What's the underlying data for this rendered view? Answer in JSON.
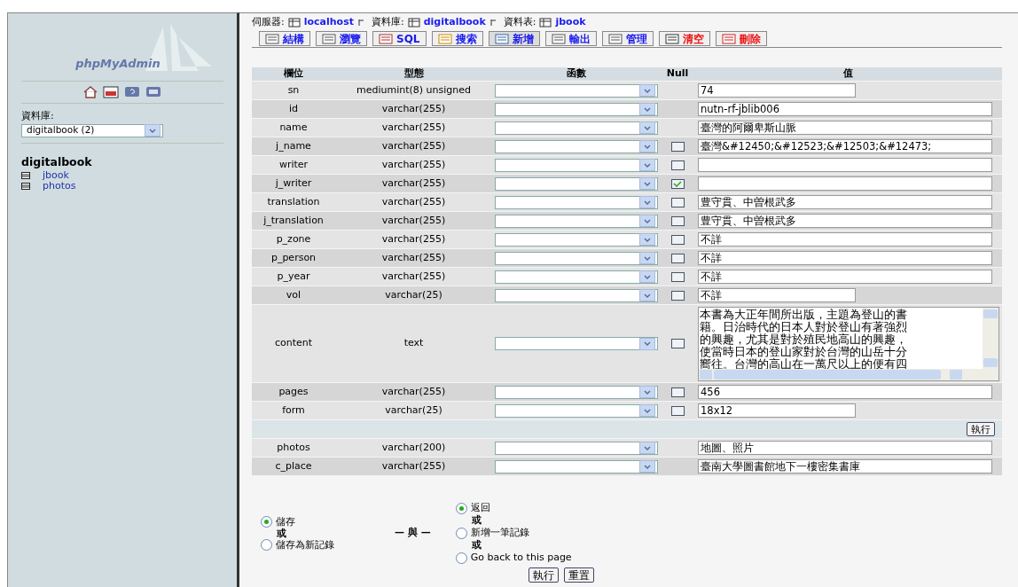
{
  "sidebar": {
    "logo": "phpMyAdmin",
    "db_label": "資料庫:",
    "db_select": "digitalbook (2)",
    "db_name": "digitalbook",
    "tables": [
      "jbook",
      "photos"
    ]
  },
  "breadcrumb": [
    {
      "label": "伺服器:",
      "value": "localhost"
    },
    {
      "label": "資料庫:",
      "value": "digitalbook"
    },
    {
      "label": "資料表:",
      "value": "jbook"
    }
  ],
  "tabs": [
    {
      "label": "結構",
      "selected": false,
      "kind": "normal"
    },
    {
      "label": "瀏覽",
      "selected": false,
      "kind": "normal"
    },
    {
      "label": "SQL",
      "selected": false,
      "kind": "normal"
    },
    {
      "label": "搜索",
      "selected": false,
      "kind": "normal"
    },
    {
      "label": "新增",
      "selected": true,
      "kind": "normal"
    },
    {
      "label": "輸出",
      "selected": false,
      "kind": "normal"
    },
    {
      "label": "管理",
      "selected": false,
      "kind": "normal"
    },
    {
      "label": "清空",
      "selected": false,
      "kind": "danger"
    },
    {
      "label": "刪除",
      "selected": false,
      "kind": "danger"
    }
  ],
  "table": {
    "columns": [
      "欄位",
      "型態",
      "函數",
      "Null",
      "值"
    ],
    "rows": [
      {
        "kind": "short",
        "field": "sn",
        "type": "mediumint(8) unsigned",
        "value": "74"
      },
      {
        "kind": "long",
        "field": "id",
        "type": "varchar(255)",
        "value": "nutn-rf-jblib006"
      },
      {
        "kind": "long",
        "field": "name",
        "type": "varchar(255)",
        "value": "臺灣的阿爾卑斯山脈"
      },
      {
        "kind": "long",
        "field": "j_name",
        "type": "varchar(255)",
        "null": false,
        "value": "臺灣&#12450;&#12523;&#12503;&#12473;"
      },
      {
        "kind": "long",
        "field": "writer",
        "type": "varchar(255)",
        "null": false,
        "value": ""
      },
      {
        "kind": "long",
        "field": "j_writer",
        "type": "varchar(255)",
        "null": true,
        "value": ""
      },
      {
        "kind": "long",
        "field": "translation",
        "type": "varchar(255)",
        "null": false,
        "value": "豊守貫、中曽根武多"
      },
      {
        "kind": "long",
        "field": "j_translation",
        "type": "varchar(255)",
        "null": false,
        "value": "豊守貫、中曽根武多"
      },
      {
        "kind": "long",
        "field": "p_zone",
        "type": "varchar(255)",
        "null": false,
        "value": "不詳"
      },
      {
        "kind": "long",
        "field": "p_person",
        "type": "varchar(255)",
        "null": false,
        "value": "不詳"
      },
      {
        "kind": "long",
        "field": "p_year",
        "type": "varchar(255)",
        "null": false,
        "value": "不詳"
      },
      {
        "kind": "short",
        "field": "vol",
        "type": "varchar(25)",
        "null": false,
        "value": "不詳"
      },
      {
        "kind": "textarea",
        "field": "content",
        "type": "text",
        "null": false,
        "value_lines": [
          "本書為大正年間所出版，主題為登山的書",
          "籍。日治時代的日本人對於登山有著強烈",
          "的興趣，尤其是對於殖民地高山的興趣，",
          "使當時日本的登山家對於台灣的山岳十分",
          "嚮往。台灣的高山在一萬尺以上的便有四"
        ]
      },
      {
        "kind": "long",
        "field": "pages",
        "type": "varchar(255)",
        "null": false,
        "value": "456"
      },
      {
        "kind": "short",
        "field": "form",
        "type": "varchar(25)",
        "null": false,
        "value": "18x12"
      },
      {
        "kind": "separator",
        "button": "執行"
      },
      {
        "kind": "long",
        "field": "photos",
        "type": "varchar(200)",
        "value": "地圖、照片"
      },
      {
        "kind": "long",
        "field": "c_place",
        "type": "varchar(255)",
        "value": "臺南大學圖書館地下一樓密集書庫"
      }
    ]
  },
  "save_options": [
    {
      "label": "儲存",
      "selected": true
    },
    {
      "label": "儲存為新記錄",
      "selected": false
    }
  ],
  "save_or_label": "或",
  "and_label": "— 與 —",
  "after_options": [
    {
      "label": "返回",
      "selected": true
    },
    {
      "label": "新增一筆記錄",
      "selected": false,
      "or_label": "或"
    },
    {
      "label": "Go back to this page",
      "selected": false,
      "or_label": "或"
    }
  ],
  "buttons": [
    "執行",
    "重置"
  ]
}
